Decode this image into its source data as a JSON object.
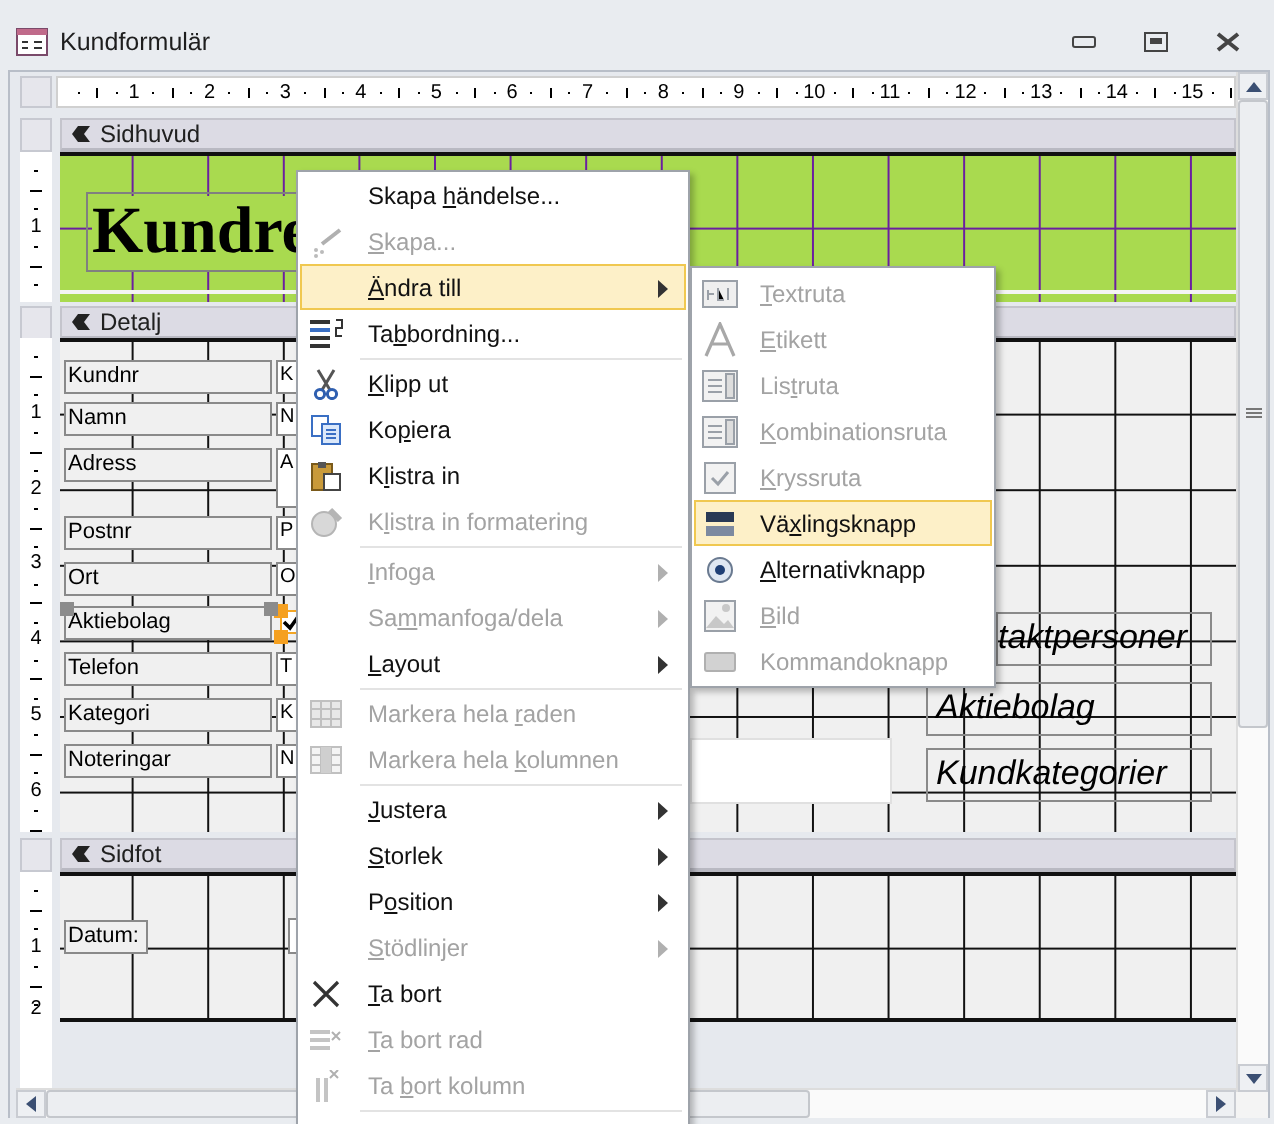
{
  "window": {
    "title": "Kundformulär"
  },
  "ruler": {
    "marks": [
      "1",
      "2",
      "3",
      "4",
      "5",
      "6",
      "7",
      "8",
      "9",
      "10",
      "11",
      "12",
      "13",
      "14",
      "15"
    ]
  },
  "sections": [
    {
      "kind": "header",
      "title": "Sidhuvud",
      "ruler_marks": [
        "1"
      ],
      "heading": "Kundre"
    },
    {
      "kind": "detail",
      "title": "Detalj",
      "ruler_marks": [
        "1",
        "2",
        "3",
        "4",
        "5",
        "6"
      ],
      "rows": [
        {
          "kind": "textbox",
          "label": "Kundnr",
          "value": "K"
        },
        {
          "kind": "textbox",
          "label": "Namn",
          "value": "N"
        },
        {
          "kind": "textbox",
          "label": "Adress",
          "value": "A"
        },
        {
          "kind": "textbox",
          "label": "Postnr",
          "value": "P"
        },
        {
          "kind": "textbox",
          "label": "Ort",
          "value": "O"
        },
        {
          "kind": "checkbox",
          "label": "Aktiebolag",
          "checked": true,
          "selected": true
        },
        {
          "kind": "textbox",
          "label": "Telefon",
          "value": "T"
        },
        {
          "kind": "textbox",
          "label": "Kategori",
          "value": "K"
        },
        {
          "kind": "textbox",
          "label": "Noteringar",
          "value": "N"
        }
      ],
      "subform_labels": [
        "taktpersoner",
        "Aktiebolag",
        "Kundkategorier"
      ]
    },
    {
      "kind": "footer",
      "title": "Sidfot",
      "ruler_marks": [
        "1",
        "2"
      ],
      "label": "Datum:"
    }
  ],
  "context_menu": {
    "items": [
      {
        "kind": "item",
        "label": {
          "before": "Skapa ",
          "key": "h",
          "after": "ändelse..."
        },
        "disabled": false,
        "has_submenu": false,
        "selected": false
      },
      {
        "kind": "item",
        "label": {
          "key": "S",
          "after": "kapa..."
        },
        "disabled": true,
        "has_submenu": false,
        "selected": false
      },
      {
        "kind": "item",
        "label": {
          "key": "Ä",
          "after": "ndra till"
        },
        "disabled": false,
        "has_submenu": true,
        "selected": true
      },
      {
        "kind": "item",
        "label": {
          "before": "Ta",
          "key": "b",
          "after": "bordning..."
        },
        "disabled": false,
        "has_submenu": false,
        "selected": false
      },
      {
        "kind": "separator"
      },
      {
        "kind": "item",
        "label": {
          "key": "K",
          "after": "lipp ut"
        },
        "disabled": false,
        "has_submenu": false,
        "selected": false
      },
      {
        "kind": "item",
        "label": {
          "before": "Ko",
          "key": "p",
          "after": "iera"
        },
        "disabled": false,
        "has_submenu": false,
        "selected": false
      },
      {
        "kind": "item",
        "label": {
          "before": "K",
          "key": "l",
          "after": "istra in"
        },
        "disabled": false,
        "has_submenu": false,
        "selected": false
      },
      {
        "kind": "item",
        "label": {
          "before": "K",
          "key": "l",
          "after": "istra in formatering"
        },
        "disabled": true,
        "has_submenu": false,
        "selected": false
      },
      {
        "kind": "separator"
      },
      {
        "kind": "item",
        "label": {
          "key": "I",
          "after": "nfoga"
        },
        "disabled": true,
        "has_submenu": true,
        "selected": false
      },
      {
        "kind": "item",
        "label": {
          "before": "Sa",
          "key": "m",
          "after": "manfoga/dela"
        },
        "disabled": true,
        "has_submenu": true,
        "selected": false
      },
      {
        "kind": "item",
        "label": {
          "key": "L",
          "after": "ayout"
        },
        "disabled": false,
        "has_submenu": true,
        "selected": false
      },
      {
        "kind": "separator"
      },
      {
        "kind": "item",
        "label": {
          "before": "Markera hela ",
          "key": "r",
          "after": "aden"
        },
        "disabled": true,
        "has_submenu": false,
        "selected": false
      },
      {
        "kind": "item",
        "label": {
          "before": "Markera hela ",
          "key": "k",
          "after": "olumnen"
        },
        "disabled": true,
        "has_submenu": false,
        "selected": false
      },
      {
        "kind": "separator"
      },
      {
        "kind": "item",
        "label": {
          "key": "J",
          "after": "ustera"
        },
        "disabled": false,
        "has_submenu": true,
        "selected": false
      },
      {
        "kind": "item",
        "label": {
          "key": "S",
          "after": "torlek"
        },
        "disabled": false,
        "has_submenu": true,
        "selected": false
      },
      {
        "kind": "item",
        "label": {
          "before": "P",
          "key": "o",
          "after": "sition"
        },
        "disabled": false,
        "has_submenu": true,
        "selected": false
      },
      {
        "kind": "item",
        "label": {
          "key": "S",
          "after": "tödlinjer"
        },
        "disabled": true,
        "has_submenu": true,
        "selected": false
      },
      {
        "kind": "item",
        "label": {
          "key": "T",
          "after": "a bort"
        },
        "disabled": false,
        "has_submenu": false,
        "selected": false
      },
      {
        "kind": "item",
        "label": {
          "key": "T",
          "after": "a bort rad"
        },
        "disabled": true,
        "has_submenu": false,
        "selected": false
      },
      {
        "kind": "item",
        "label": {
          "before": "Ta ",
          "key": "b",
          "after": "ort kolumn"
        },
        "disabled": true,
        "has_submenu": false,
        "selected": false
      },
      {
        "kind": "separator"
      }
    ]
  },
  "submenu": {
    "items": [
      {
        "label": {
          "key": "T",
          "after": "extruta"
        },
        "disabled": true,
        "selected": false
      },
      {
        "label": {
          "key": "E",
          "after": "tikett"
        },
        "disabled": true,
        "selected": false
      },
      {
        "label": {
          "before": "Lis",
          "key": "t",
          "after": "ruta"
        },
        "disabled": true,
        "selected": false
      },
      {
        "label": {
          "key": "K",
          "after": "ombinationsruta"
        },
        "disabled": true,
        "selected": false
      },
      {
        "label": {
          "key": "K",
          "after": "ryssruta"
        },
        "disabled": true,
        "selected": false
      },
      {
        "label": {
          "before": "Vä",
          "key": "x",
          "after": "lingsknapp"
        },
        "disabled": false,
        "selected": true
      },
      {
        "label": {
          "key": "A",
          "after": "lternativknapp"
        },
        "disabled": false,
        "selected": false
      },
      {
        "label": {
          "key": "B",
          "after": "ild"
        },
        "disabled": true,
        "selected": false
      },
      {
        "label": {
          "before": "Kommandoknapp"
        },
        "disabled": true,
        "selected": false
      }
    ]
  }
}
